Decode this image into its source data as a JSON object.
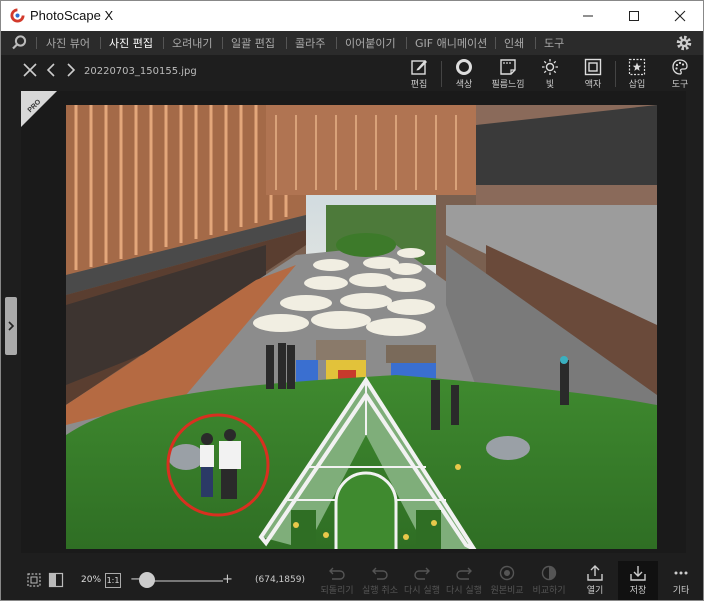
{
  "app": {
    "title": "PhotoScape X"
  },
  "menu": {
    "items": [
      "사진 뷰어",
      "사진 편집",
      "오려내기",
      "일괄 편집",
      "콜라주",
      "이어붙이기",
      "GIF 애니메이션",
      "인쇄",
      "도구"
    ],
    "active_index": 1
  },
  "file": {
    "name": "20220703_150155.jpg"
  },
  "tools": [
    {
      "label": "편집",
      "icon": "edit-icon"
    },
    {
      "label": "색상",
      "icon": "circle-icon"
    },
    {
      "label": "필름느낌",
      "icon": "film-icon"
    },
    {
      "label": "빛",
      "icon": "sun-icon"
    },
    {
      "label": "액자",
      "icon": "frame-icon"
    },
    {
      "label": "삽입",
      "icon": "star-frame-icon"
    },
    {
      "label": "도구",
      "icon": "palette-icon"
    }
  ],
  "badge": {
    "text": "PRO"
  },
  "status": {
    "zoom": "20%",
    "one_to_one": "1:1",
    "coords": "(674,1859)",
    "zoom_slider_fraction": 0.05
  },
  "actions": {
    "undo_all": "되돌리기",
    "undo": "실행 취소",
    "redo": "다시 실행",
    "redo_all": "다시 실행",
    "compare": "원본비교",
    "compare2": "비교하기",
    "open": "열기",
    "save": "저장",
    "more": "기타"
  }
}
